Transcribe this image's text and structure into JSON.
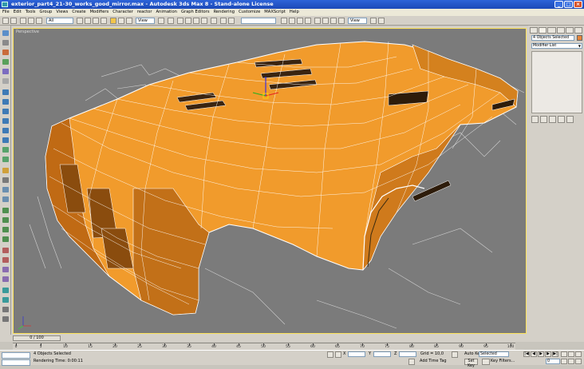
{
  "window": {
    "title": "exterior_part4_21-30_works_good_mirror.max - Autodesk 3ds Max 8 - Stand-alone License",
    "minimize": "_",
    "maximize": "□",
    "close": "×"
  },
  "menu": [
    "File",
    "Edit",
    "Tools",
    "Group",
    "Views",
    "Create",
    "Modifiers",
    "Character",
    "reactor",
    "Animation",
    "Graph Editors",
    "Rendering",
    "Customize",
    "MAXScript",
    "Help"
  ],
  "toolbar": {
    "selection_filter": "All",
    "ref_coord": "View",
    "named_selection": "",
    "view_dropdown": "View"
  },
  "viewport": {
    "label": "Perspective",
    "model_color": "#f19b2c",
    "wire_color": "#ffffff"
  },
  "command_panel": {
    "selection_field": "4 Objects Selected",
    "modifier_list": "Modifier List"
  },
  "timeline": {
    "slider_label": "0 / 100",
    "ticks": [
      "0",
      "5",
      "10",
      "15",
      "20",
      "25",
      "30",
      "35",
      "40",
      "45",
      "50",
      "55",
      "60",
      "65",
      "70",
      "75",
      "80",
      "85",
      "90",
      "95",
      "100"
    ]
  },
  "status": {
    "selection_text": "4 Objects Selected",
    "prompt_text": "Rendering Time: 0:00:11",
    "x_label": "X",
    "x_value": "",
    "y_label": "Y",
    "y_value": "",
    "z_label": "Z",
    "z_value": "",
    "grid": "Grid = 10,0",
    "add_time_tag": "Add Time Tag",
    "auto_key": "Auto Key",
    "set_key": "Set Key",
    "key_mode": "Selected",
    "key_filters": "Key Filters...",
    "frame": "0"
  }
}
